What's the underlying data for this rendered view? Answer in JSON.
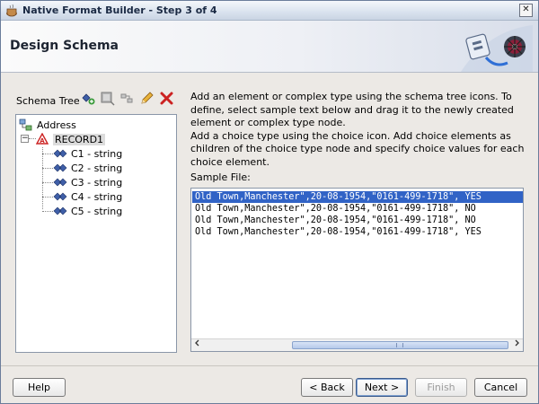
{
  "window": {
    "title": "Native Format Builder - Step 3 of 4",
    "close_glyph": "✕"
  },
  "header": {
    "title": "Design Schema"
  },
  "schema_tree": {
    "label": "Schema Tree",
    "tools": [
      "add-element-icon",
      "add-complex-type-icon",
      "add-choice-icon",
      "edit-icon",
      "delete-icon"
    ],
    "root": "Address",
    "record": "RECORD1",
    "expander": "−",
    "children": [
      "C1 - string",
      "C2 - string",
      "C3 - string",
      "C4 - string",
      "C5 - string"
    ]
  },
  "instructions": {
    "paragraph1": "Add an element or complex type using the schema tree icons. To define, select sample text below and drag it to the newly created element or complex type node.",
    "paragraph2": "Add a choice type using the choice icon. Add choice elements as children of the choice type node and specify choice values for each choice element."
  },
  "sample_file": {
    "label": "Sample File:",
    "lines": [
      "Old Town,Manchester\",20-08-1954,\"0161-499-1718\", YES",
      "Old Town,Manchester\",20-08-1954,\"0161-499-1718\", NO",
      "Old Town,Manchester\",20-08-1954,\"0161-499-1718\", NO",
      "Old Town,Manchester\",20-08-1954,\"0161-499-1718\", YES"
    ],
    "selected_index": 0
  },
  "buttons": {
    "help": "Help",
    "back": "< Back",
    "next": "Next >",
    "finish": "Finish",
    "cancel": "Cancel"
  },
  "colors": {
    "selection": "#3163c6",
    "delete": "#cc2222",
    "element_icon": "#3f5fa8"
  }
}
